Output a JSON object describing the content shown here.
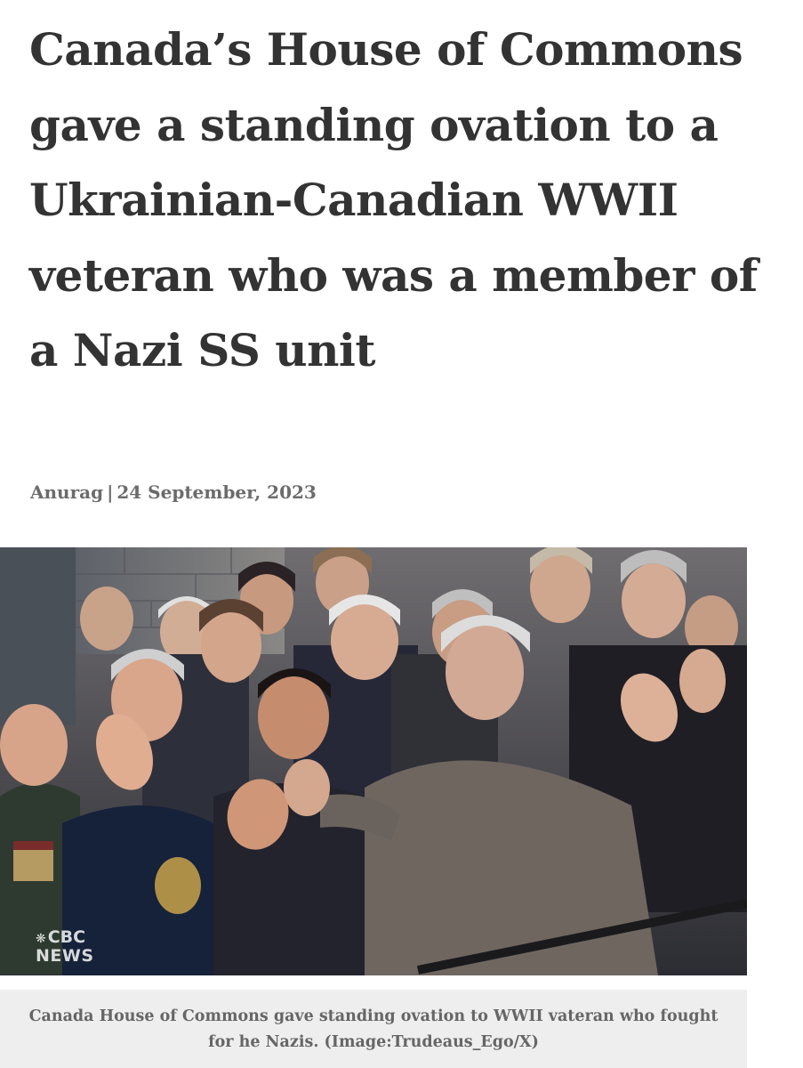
{
  "article": {
    "headline": "Canada’s House of Commons gave a standing ovation to a Ukrainian-Canadian WWII veteran who was a member of a Nazi SS unit",
    "author": "Anurag",
    "separator": "|",
    "date": "24 September, 2023"
  },
  "image": {
    "watermark_brand": "CBC",
    "watermark_sub": "NEWS",
    "caption": "Canada House of Commons gave standing ovation to WWII vateran who fought for he Nazis. (Image:Trudeaus_Ego/X)"
  },
  "colors": {
    "headline": "#333333",
    "byline": "#6b6b6b",
    "caption_bg": "#eeeeee",
    "caption_text": "#666666"
  }
}
